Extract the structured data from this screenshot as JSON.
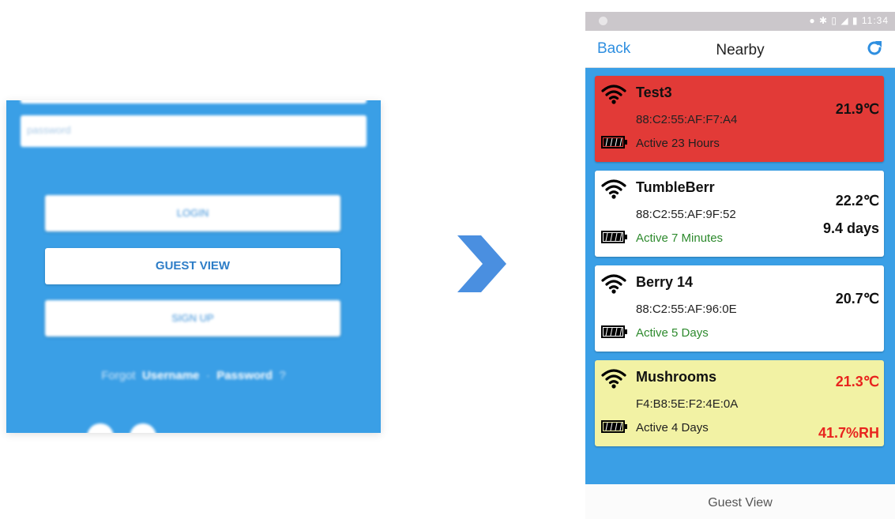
{
  "login": {
    "password_placeholder": "password",
    "login_label": "LOGIN",
    "guest_label": "GUEST VIEW",
    "signup_label": "SIGN UP",
    "forgot_prefix": "Forgot",
    "forgot_username": "Username",
    "forgot_sep": "·",
    "forgot_password": "Password",
    "forgot_suffix": "?"
  },
  "arrow_icon": "chevron-right-icon",
  "status": {
    "time": "11:34",
    "icons": "location bluetooth vibrate signal battery"
  },
  "nav": {
    "back": "Back",
    "title": "Nearby",
    "refresh_icon": "refresh-icon"
  },
  "devices": [
    {
      "name": "Test3",
      "mac": "88:C2:55:AF:F7:A4",
      "active": "Active 23 Hours",
      "temp": "21.9℃",
      "extra": "",
      "style": "red"
    },
    {
      "name": "TumbleBerr",
      "mac": "88:C2:55:AF:9F:52",
      "active": "Active 7 Minutes",
      "temp": "22.2℃",
      "extra": "9.4 days",
      "style": "white"
    },
    {
      "name": "Berry 14",
      "mac": "88:C2:55:AF:96:0E",
      "active": "Active 5 Days",
      "temp": "20.7℃",
      "extra": "",
      "style": "white"
    },
    {
      "name": "Mushrooms",
      "mac": "F4:B8:5E:F2:4E:0A",
      "active": "Active 4 Days",
      "temp": "21.3℃",
      "extra": "41.7%RH",
      "style": "yellow"
    }
  ],
  "footer": {
    "label": "Guest View"
  },
  "colors": {
    "app_blue": "#3a9fe6",
    "alarm_red": "#e23a37",
    "warn_yellow": "#f2f2a4",
    "ok_green": "#2d8a2d",
    "link_blue": "#2f8fe0"
  }
}
